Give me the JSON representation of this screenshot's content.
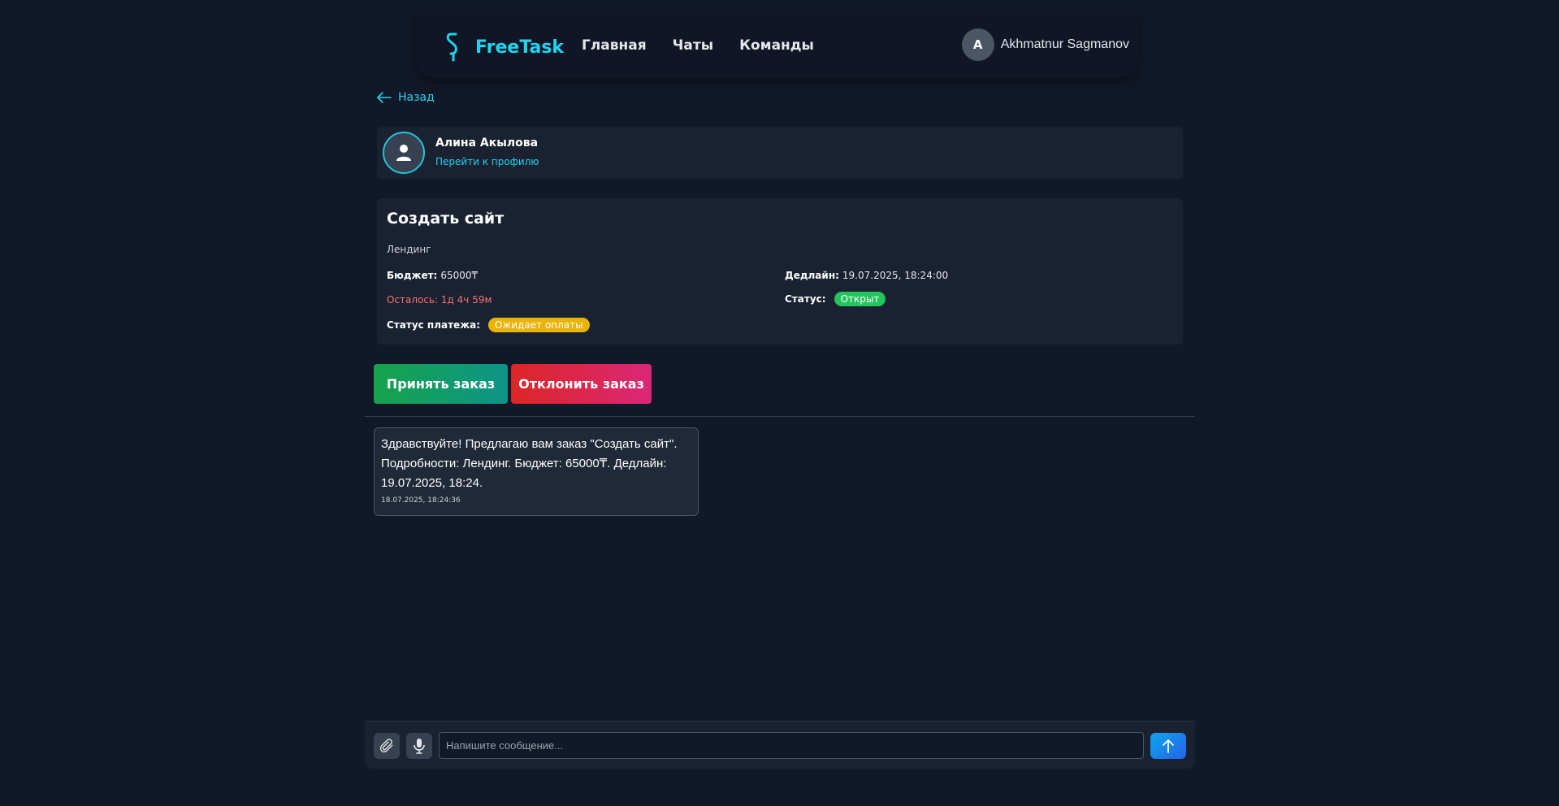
{
  "navbar": {
    "brand": "FreeTask",
    "links": [
      {
        "label": "Главная"
      },
      {
        "label": "Чаты"
      },
      {
        "label": "Команды"
      }
    ],
    "user": {
      "initial": "A",
      "name": "Akhmatnur Sagmanov"
    }
  },
  "back_label": "Назад",
  "profile": {
    "name": "Алина Акылова",
    "link_label": "Перейти к профилю"
  },
  "order": {
    "title": "Создать сайт",
    "description": "Лендинг",
    "budget_label": "Бюджет:",
    "budget_value": "65000₸",
    "deadline_label": "Дедлайн:",
    "deadline_value": "19.07.2025, 18:24:00",
    "remaining": "Осталось: 1д 4ч 59м",
    "status_label": "Статус:",
    "status_value": "Открыт",
    "payment_label": "Статус платежа:",
    "payment_value": "Ожидает оплаты"
  },
  "actions": {
    "accept_label": "Принять заказ",
    "decline_label": "Отклонить заказ"
  },
  "messages": [
    {
      "text": "Здравствуйте! Предлагаю вам заказ \"Создать сайт\". Подробности: Лендинг. Бюджет: 65000₸. Дедлайн: 19.07.2025, 18:24.",
      "time": "18.07.2025, 18:24:36"
    }
  ],
  "composer": {
    "placeholder": "Напишите сообщение..."
  },
  "icons": {
    "logo": "dollar-icon",
    "back": "arrow-left-icon",
    "profile_avatar": "user-icon",
    "attach": "paperclip-icon",
    "mic": "microphone-icon",
    "send": "arrow-up-icon"
  },
  "colors": {
    "background": "#111827",
    "card": "#1a2232",
    "accent": "#22d3ee",
    "accept_gradient": [
      "#16a34a",
      "#0d9488"
    ],
    "decline_gradient": [
      "#dc2626",
      "#db2777"
    ],
    "status_open": "#22c55e",
    "payment_pending": "#eab308",
    "remaining_text": "#f87171"
  }
}
